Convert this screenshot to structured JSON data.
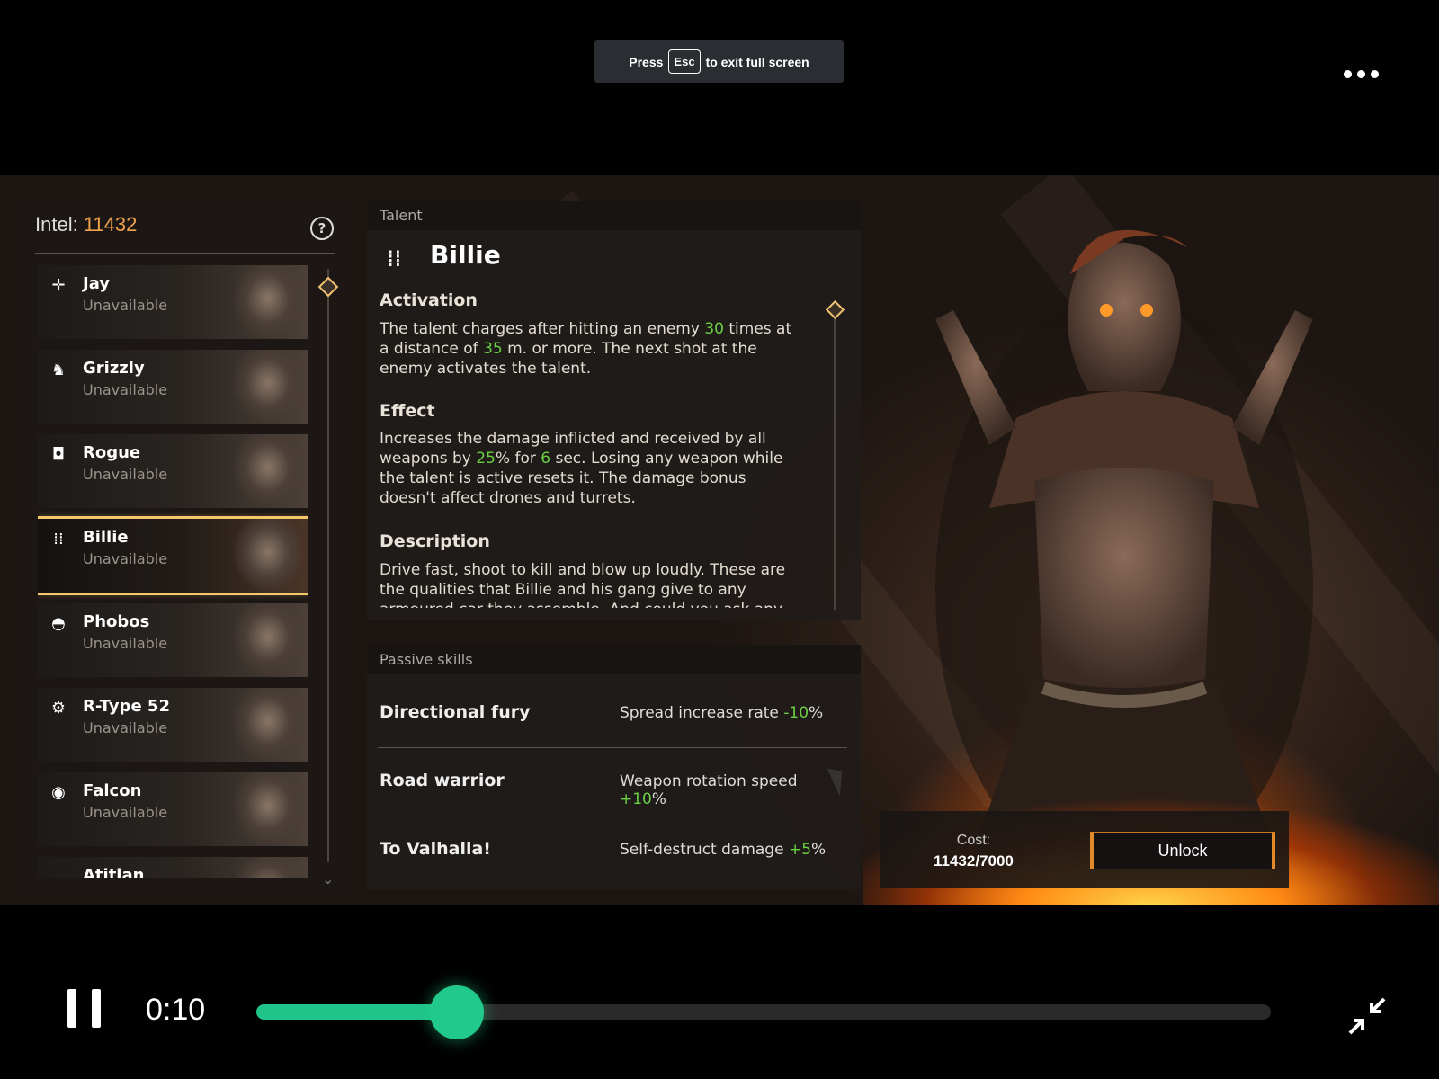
{
  "fullscreen_toast": {
    "press": "Press",
    "key": "Esc",
    "suffix": "to exit full screen"
  },
  "menu": {
    "icon": "more-horizontal-icon"
  },
  "intel": {
    "label": "Intel:",
    "value": "11432"
  },
  "characters": [
    {
      "name": "Jay",
      "status": "Unavailable",
      "icon": "crosshair-icon",
      "selected": false
    },
    {
      "name": "Grizzly",
      "status": "Unavailable",
      "icon": "bear-paw-icon",
      "selected": false
    },
    {
      "name": "Rogue",
      "status": "Unavailable",
      "icon": "target-icon",
      "selected": false
    },
    {
      "name": "Billie",
      "status": "Unavailable",
      "icon": "bullets-icon",
      "selected": true
    },
    {
      "name": "Phobos",
      "status": "Unavailable",
      "icon": "mask-icon",
      "selected": false
    },
    {
      "name": "R-Type 52",
      "status": "Unavailable",
      "icon": "gear-icon",
      "selected": false
    },
    {
      "name": "Falcon",
      "status": "Unavailable",
      "icon": "eye-icon",
      "selected": false
    },
    {
      "name": "Atitlan",
      "status": "",
      "icon": "chevron-icon",
      "selected": false
    }
  ],
  "talent": {
    "header": "Talent",
    "name": "Billie",
    "activation_title": "Activation",
    "activation": {
      "p1": "The talent charges after hitting an enemy ",
      "n1": "30",
      "p2": " times at a distance of ",
      "n2": "35",
      "p3": " m. or more. The next shot at the enemy activates the talent."
    },
    "effect_title": "Effect",
    "effect": {
      "p1": "Increases the damage inflicted and received by all weapons by ",
      "n1": "25",
      "p2": "% for ",
      "n2": "6",
      "p3": " sec. Losing any weapon while the talent is active resets it. The damage bonus doesn't affect drones and turrets."
    },
    "description_title": "Description",
    "description": "Drive fast, shoot to kill and blow up loudly. These are the qualities that Billie and his gang give to any armoured car they assemble. And could you ask any more of their"
  },
  "passive": {
    "header": "Passive skills",
    "skills": [
      {
        "name": "Directional fury",
        "stat": "Spread increase rate ",
        "mod": "-10",
        "unit": "%"
      },
      {
        "name": "Road warrior",
        "stat": "Weapon rotation speed ",
        "mod": "+10",
        "unit": "%"
      },
      {
        "name": "To Valhalla!",
        "stat": "Self-destruct damage ",
        "mod": "+5",
        "unit": "%"
      }
    ]
  },
  "cost": {
    "label": "Cost:",
    "value": "11432/7000"
  },
  "unlock_label": "Unlock",
  "player": {
    "time": "0:10",
    "progress": 0.198
  },
  "colors": {
    "accent": "#f0a24a",
    "green": "#6ad043",
    "player": "#20c48a"
  }
}
